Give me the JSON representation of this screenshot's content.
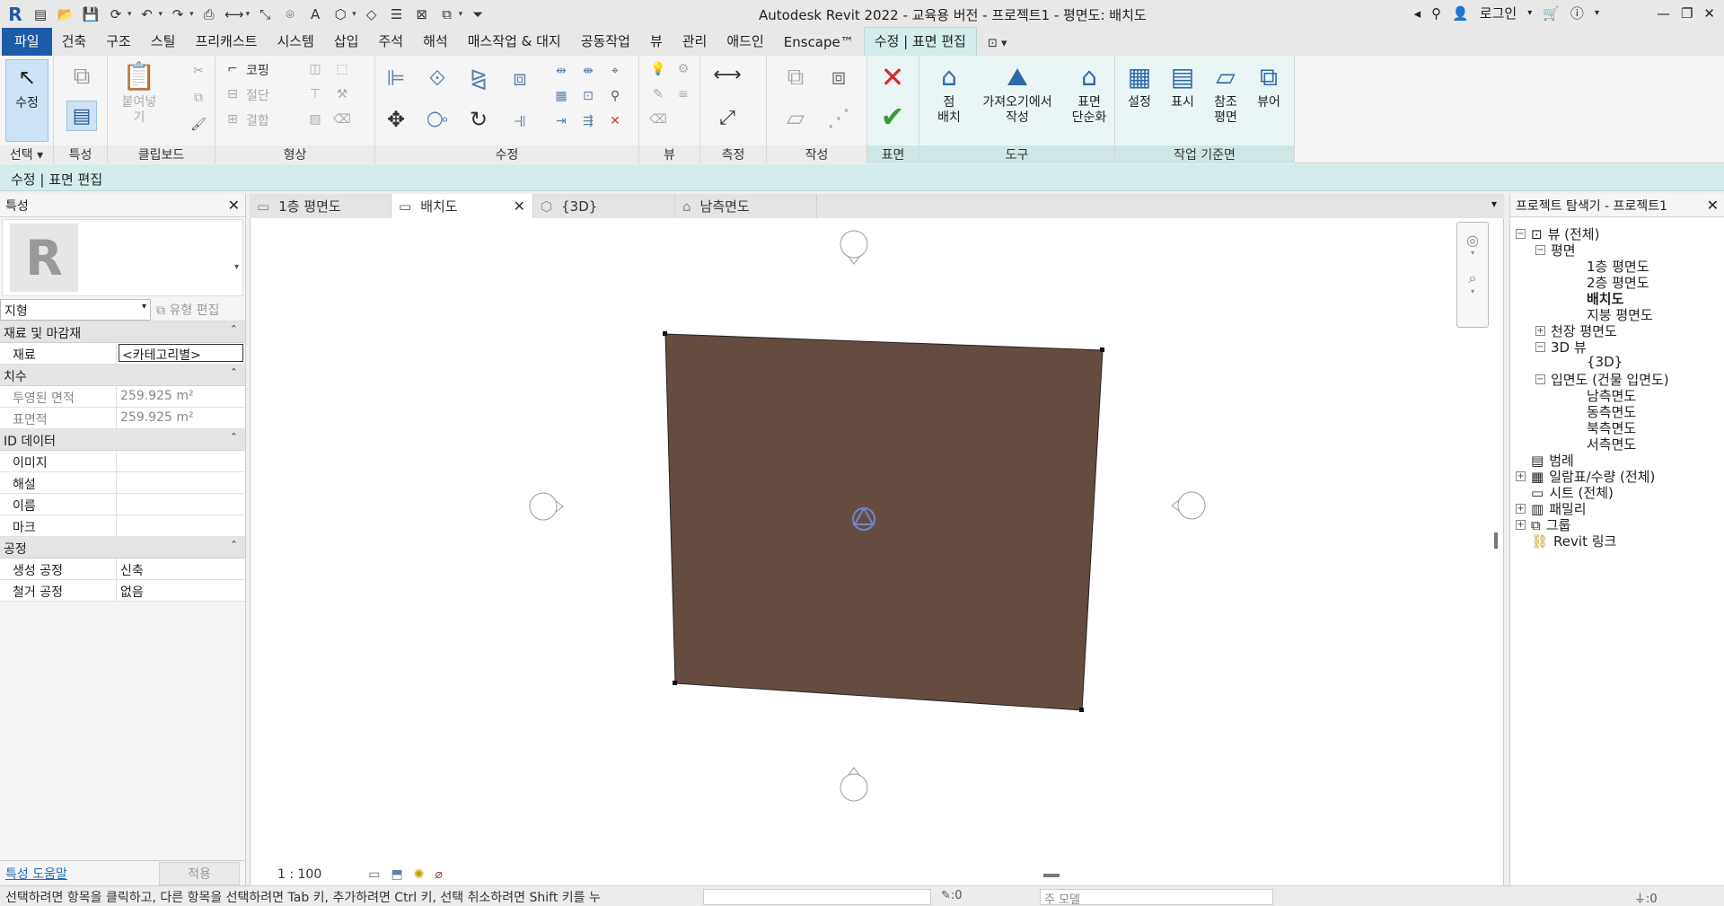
{
  "app": {
    "title": "Autodesk Revit 2022 - 교육용 버전 - 프로젝트1 - 평면도: 배치도",
    "login": "로그인"
  },
  "ribbon_tabs": [
    "파일",
    "건축",
    "구조",
    "스틸",
    "프리캐스트",
    "시스템",
    "삽입",
    "주석",
    "해석",
    "매스작업 & 대지",
    "공동작업",
    "뷰",
    "관리",
    "애드인",
    "Enscape™",
    "수정 | 표면 편집"
  ],
  "ribbon": {
    "panels": {
      "select": "선택",
      "properties": "특성",
      "clipboard": "클립보드",
      "geometry": "형상",
      "modify": "수정",
      "view": "뷰",
      "measure": "측정",
      "create": "작성",
      "surface": "표면",
      "tools": "도구",
      "workplane": "작업 기준면"
    },
    "buttons": {
      "modify": "수정",
      "paste": "붙여넣기",
      "cope": "코핑",
      "cut": "절단",
      "join": "결합",
      "place_point": "점\n배치",
      "create_from_import": "가져오기에서\n작성",
      "simplify_surface": "표면\n단순화",
      "set": "설정",
      "show": "표시",
      "ref_plane": "참조\n평면",
      "viewer": "뷰어"
    }
  },
  "context_bar": "수정 | 표면 편집",
  "properties": {
    "title": "특성",
    "type": "지형",
    "edit_type": "유형 편집",
    "groups": [
      {
        "name": "재료 및 마감재",
        "rows": [
          {
            "k": "재료",
            "v": "<카테고리별>"
          }
        ]
      },
      {
        "name": "치수",
        "rows": [
          {
            "k": "투영된 면적",
            "v": "259.925 m²"
          },
          {
            "k": "표면적",
            "v": "259.925 m²"
          }
        ]
      },
      {
        "name": "ID 데이터",
        "rows": [
          {
            "k": "이미지",
            "v": ""
          },
          {
            "k": "해설",
            "v": ""
          },
          {
            "k": "이름",
            "v": ""
          },
          {
            "k": "마크",
            "v": ""
          }
        ]
      },
      {
        "name": "공정",
        "rows": [
          {
            "k": "생성 공정",
            "v": "신축"
          },
          {
            "k": "철거 공정",
            "v": "없음"
          }
        ]
      }
    ],
    "help": "특성 도움말",
    "apply": "적용"
  },
  "view_tabs": [
    {
      "label": "1층 평면도",
      "active": false
    },
    {
      "label": "배치도",
      "active": true
    },
    {
      "label": "{3D}",
      "active": false
    },
    {
      "label": "남측면도",
      "active": false
    }
  ],
  "canvas": {
    "scale": "1 : 100",
    "surface_color": "#654c40"
  },
  "browser": {
    "title": "프로젝트 탐색기 - 프로젝트1",
    "items": {
      "views": "뷰 (전체)",
      "plans": "평면",
      "plan1": "1층 평면도",
      "plan2": "2층 평면도",
      "site": "배치도",
      "roof": "지붕 평면도",
      "ceiling": "천장 평면도",
      "view3d": "3D 뷰",
      "view3d_item": "{3D}",
      "elev": "입면도 (건물 입면도)",
      "south": "남측면도",
      "east": "동측면도",
      "north": "북측면도",
      "west": "서측면도",
      "legend": "범례",
      "schedules": "일람표/수량 (전체)",
      "sheets": "시트 (전체)",
      "families": "패밀리",
      "groups": "그룹",
      "links": "Revit 링크"
    }
  },
  "status": {
    "text": "선택하려면 항목을 클릭하고, 다른 항목을 선택하려면 Tab 키, 추가하려면 Ctrl 키, 선택 취소하려면 Shift 키를 누",
    "count": ":0",
    "model": "주 모델",
    "filter": ":0"
  }
}
